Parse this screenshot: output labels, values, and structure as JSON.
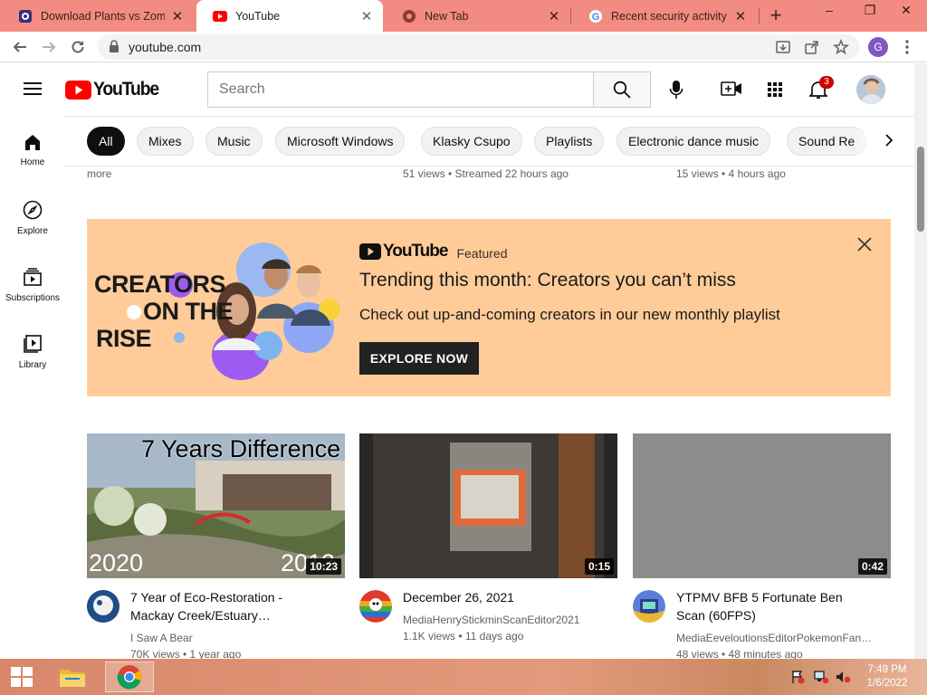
{
  "tabs": [
    {
      "title": "Download Plants vs Zombies",
      "favicon": "game-icon"
    },
    {
      "title": "YouTube",
      "favicon": "youtube-icon",
      "active": true
    },
    {
      "title": "New Tab",
      "favicon": "chrome-icon"
    },
    {
      "title": "Recent security activity",
      "favicon": "google-icon"
    }
  ],
  "window_controls": {
    "minimize": "–",
    "restore": "❐",
    "close": "✕"
  },
  "toolbar": {
    "url": "youtube.com"
  },
  "profile_initial": "G",
  "masthead": {
    "logo_text": "YouTube",
    "search_placeholder": "Search",
    "notification_count": "3"
  },
  "chips": [
    "All",
    "Mixes",
    "Music",
    "Microsoft Windows",
    "Klasky Csupo",
    "Playlists",
    "Electronic dance music",
    "Sound Re"
  ],
  "guide": [
    {
      "label": "Home",
      "icon": "home-icon"
    },
    {
      "label": "Explore",
      "icon": "compass-icon"
    },
    {
      "label": "Subscriptions",
      "icon": "subscriptions-icon"
    },
    {
      "label": "Library",
      "icon": "library-icon"
    }
  ],
  "prev_row": {
    "col1": "more",
    "col2": "51 views • Streamed 22 hours ago",
    "col3": "15 views • 4 hours ago"
  },
  "promo": {
    "brand": "YouTube",
    "featured": "Featured",
    "title": "Trending this month: Creators you can’t miss",
    "subtitle": "Check out up-and-coming creators in our new monthly playlist",
    "cta": "EXPLORE NOW",
    "art_text": [
      "CREATORS",
      "ON THE",
      "RISE"
    ]
  },
  "videos": [
    {
      "title_line1": "7 Year of Eco-Restoration -",
      "title_line2": "Mackay Creek/Estuary…",
      "channel": "I Saw A Bear",
      "meta": "70K views • 1 year ago",
      "duration": "10:23",
      "thumb_text": "7 Years Difference",
      "thumb_left": "2020",
      "thumb_right": "2013"
    },
    {
      "title_line1": "December 26, 2021",
      "title_line2": "",
      "channel": "MediaHenryStickminScanEditor2021",
      "meta": "1.1K views • 11 days ago",
      "duration": "0:15"
    },
    {
      "title_line1": "YTPMV BFB 5 Fortunate Ben",
      "title_line2": "Scan (60FPS)",
      "channel": "MediaEeveloutionsEditorPokemonFan…",
      "meta": "48 views • 48 minutes ago",
      "duration": "0:42"
    }
  ],
  "taskbar": {
    "time": "7:49 PM",
    "date": "1/6/2022"
  },
  "colors": {
    "tabstrip": "#f28b82",
    "youtube_red": "#ff0000",
    "promo_bg": "#ffcc99",
    "taskbar": "#d9876b"
  }
}
